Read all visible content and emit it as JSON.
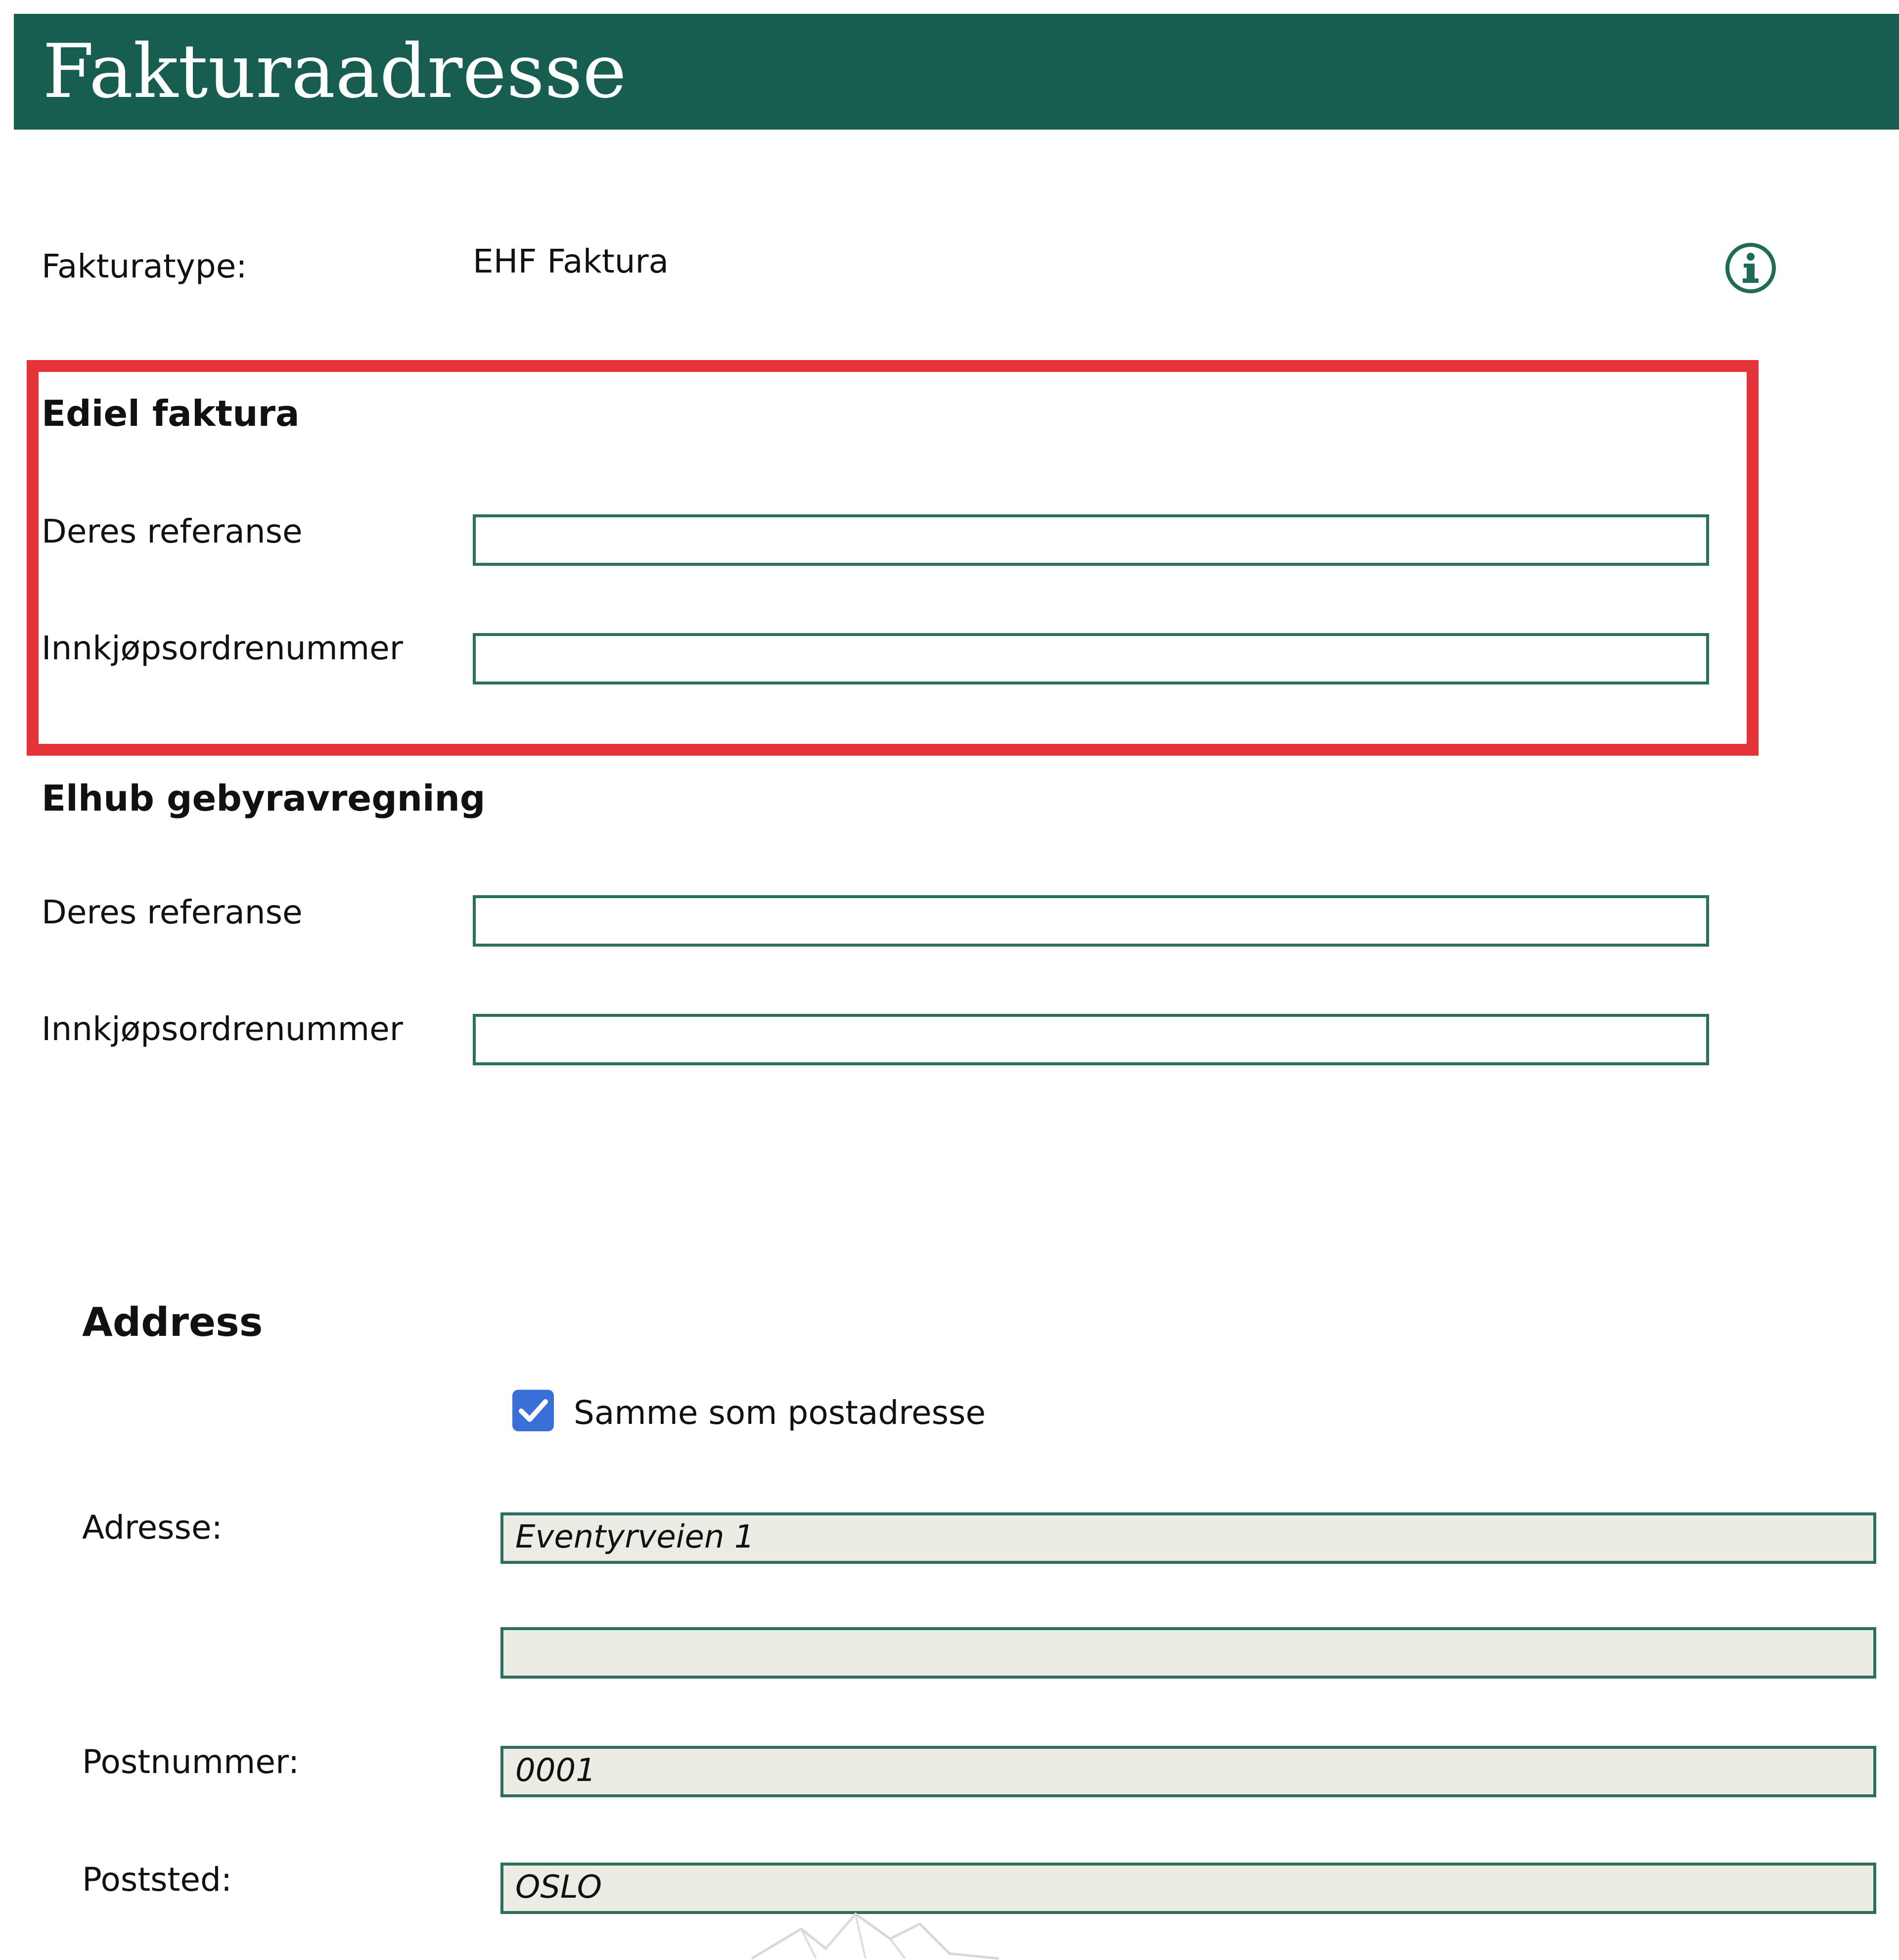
{
  "header": {
    "title": "Fakturaadresse"
  },
  "invoice_type": {
    "label": "Fakturatype:",
    "value": "EHF Faktura"
  },
  "ediel": {
    "heading": "Ediel faktura",
    "reference_label": "Deres referanse",
    "reference_value": "",
    "po_label": "Innkjøpsordrenummer",
    "po_value": ""
  },
  "elhub": {
    "heading": "Elhub gebyravregning",
    "reference_label": "Deres referanse",
    "reference_value": "",
    "po_label": "Innkjøpsordrenummer",
    "po_value": ""
  },
  "address": {
    "heading": "Address",
    "same_as_postal_label": "Samme som postadresse",
    "same_as_postal_checked": true,
    "address_label": "Adresse:",
    "address_line1": "Eventyrveien 1",
    "address_line2": "",
    "postcode_label": "Postnummer:",
    "postcode_value": "0001",
    "city_label": "Poststed:",
    "city_value": "OSLO"
  },
  "colors": {
    "header_bg": "#175e50",
    "field_border": "#2e6e5e",
    "readonly_bg": "#ecebe4",
    "highlight": "#e4343a",
    "checkbox": "#3a6fd8"
  }
}
